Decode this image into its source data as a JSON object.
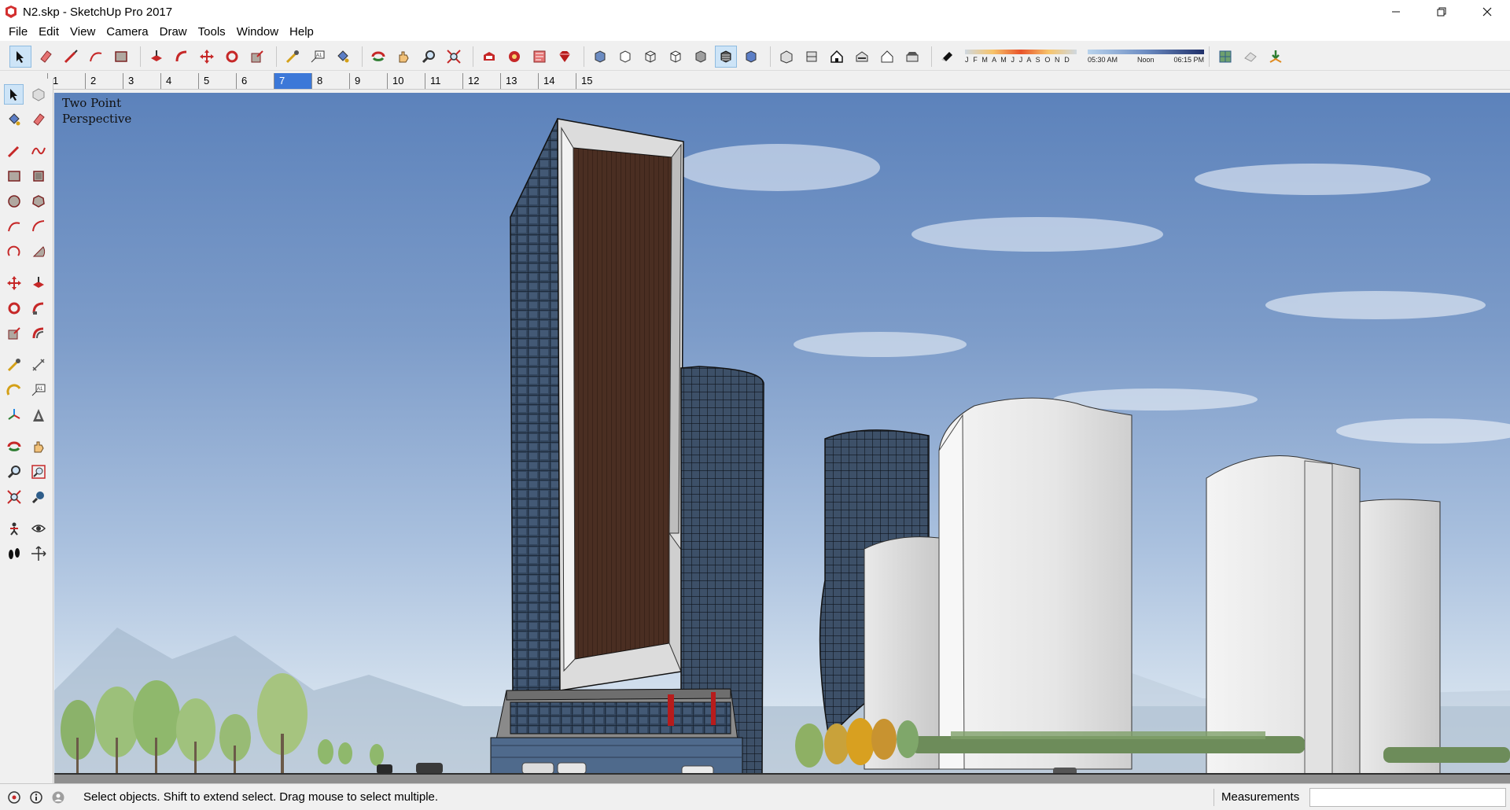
{
  "window": {
    "title": "N2.skp - SketchUp Pro 2017",
    "controls": [
      "minimize-icon",
      "restore-icon",
      "close-icon"
    ]
  },
  "menu": [
    "File",
    "Edit",
    "View",
    "Camera",
    "Draw",
    "Tools",
    "Window",
    "Help"
  ],
  "toolbar": {
    "icons": [
      "select-icon",
      "eraser-icon",
      "line-icon",
      "arc-icon",
      "rectangle-icon",
      "push-pull-icon",
      "follow-me-icon",
      "move-icon",
      "rotate-icon",
      "scale-icon",
      "tape-measure-icon",
      "text-icon",
      "paint-bucket-icon",
      "orbit-icon",
      "pan-icon",
      "zoom-icon",
      "zoom-extents-icon",
      "warehouse-icon",
      "extension-warehouse-icon",
      "layout-icon",
      "ruby-icon",
      "xray-icon",
      "back-edges-icon",
      "wireframe-icon",
      "hidden-line-icon",
      "shaded-icon",
      "shaded-textures-icon",
      "monochrome-icon",
      "iso-view-icon",
      "top-view-icon",
      "front-view-icon",
      "right-view-icon",
      "back-view-icon",
      "left-view-icon",
      "shadows-icon"
    ],
    "shadow_months": "J F M A M J J A S O N D",
    "time_start": "05:30 AM",
    "time_noon": "Noon",
    "time_end": "06:15 PM",
    "trailing_icons": [
      "geo-location-icon",
      "add-location-icon",
      "toggle-terrain-icon"
    ]
  },
  "scenes": {
    "tabs": [
      "1",
      "2",
      "3",
      "4",
      "5",
      "6",
      "7",
      "8",
      "9",
      "10",
      "11",
      "12",
      "13",
      "14",
      "15"
    ],
    "active": "7"
  },
  "left_tools": [
    "select-icon",
    "make-component-icon",
    "paint-bucket-icon",
    "eraser-icon",
    "line-icon",
    "freehand-icon",
    "rectangle-icon",
    "rotated-rectangle-icon",
    "circle-icon",
    "polygon-icon",
    "arc-icon",
    "two-point-arc-icon",
    "three-point-arc-icon",
    "pie-icon",
    "move-icon",
    "push-pull-icon",
    "rotate-icon",
    "follow-me-icon",
    "scale-icon",
    "offset-icon",
    "tape-measure-icon",
    "dimension-icon",
    "protractor-icon",
    "text-icon",
    "axes-icon",
    "3d-text-icon",
    "orbit-icon",
    "pan-icon",
    "zoom-icon",
    "zoom-window-icon",
    "zoom-extents-icon",
    "previous-view-icon",
    "position-camera-icon",
    "look-around-icon",
    "walk-icon",
    "section-plane-icon"
  ],
  "viewport": {
    "camera_label_line1": "Two Point",
    "camera_label_line2": "Perspective",
    "sky_color": "#6f92c4"
  },
  "status": {
    "message": "Select objects. Shift to extend select. Drag mouse to select multiple.",
    "measurements_label": "Measurements",
    "measurements_value": ""
  }
}
